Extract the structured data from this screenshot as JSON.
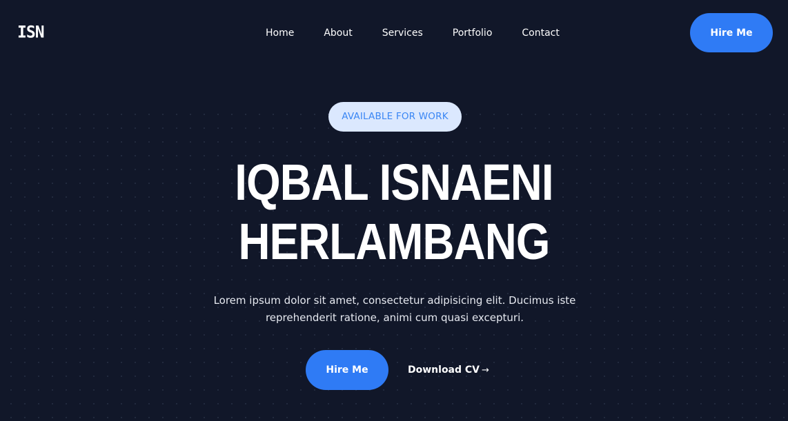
{
  "header": {
    "logo": "ISN",
    "nav": [
      {
        "label": "Home"
      },
      {
        "label": "About"
      },
      {
        "label": "Services"
      },
      {
        "label": "Portfolio"
      },
      {
        "label": "Contact"
      }
    ],
    "cta_label": "Hire Me"
  },
  "hero": {
    "badge": "AVAILABLE FOR WORK",
    "title_line1": "IQBAL ISNAENI",
    "title_line2": "HERLAMBANG",
    "description": "Lorem ipsum dolor sit amet, consectetur adipisicing elit. Ducimus iste reprehenderit ratione, animi cum quasi excepturi.",
    "primary_cta": "Hire Me",
    "secondary_cta": "Download CV",
    "secondary_cta_icon": "arrow-right-icon",
    "secondary_cta_glyph": "→"
  },
  "colors": {
    "background": "#111729",
    "accent": "#2f7bf5",
    "badge_bg": "#dbe8fe",
    "badge_text": "#3a86f4"
  }
}
